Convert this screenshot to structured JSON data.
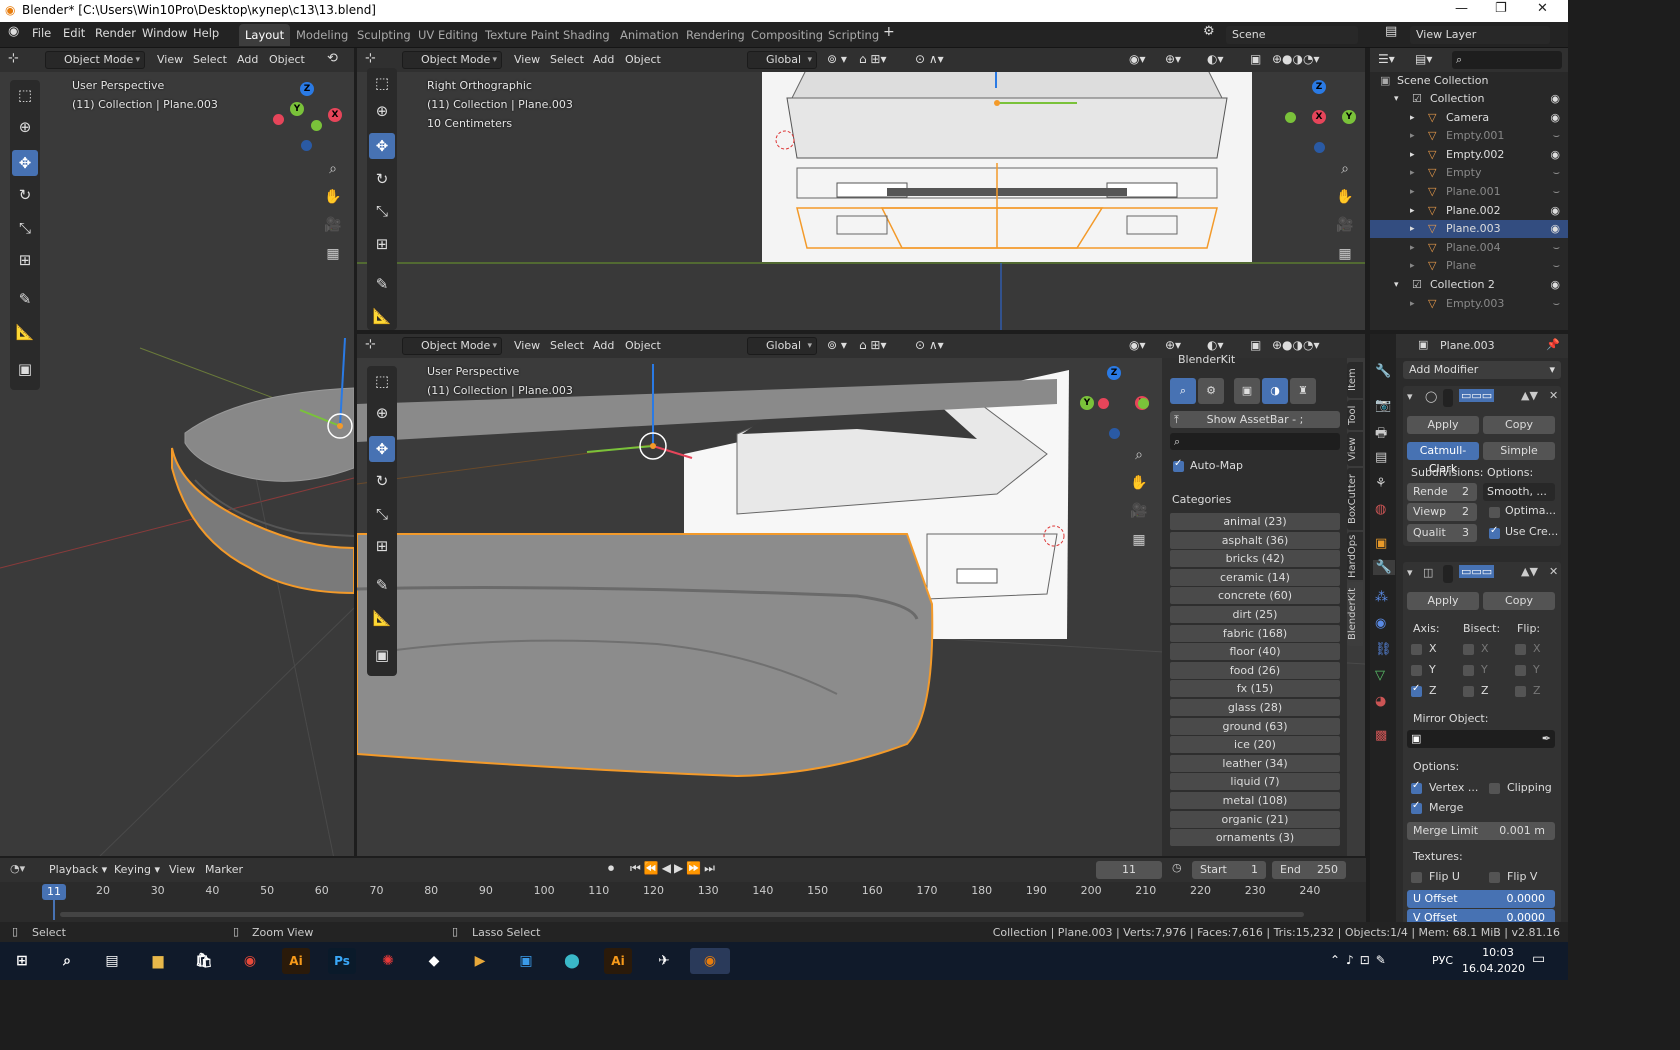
{
  "window": {
    "title": "Blender* [C:\\Users\\Win10Pro\\Desktop\\купер\\c13\\13.blend]"
  },
  "menu": [
    "File",
    "Edit",
    "Render",
    "Window",
    "Help"
  ],
  "workspaces": [
    "Layout",
    "Modeling",
    "Sculpting",
    "UV Editing",
    "Texture Paint",
    "Shading",
    "Animation",
    "Rendering",
    "Compositing",
    "Scripting"
  ],
  "scene": "Scene",
  "view_layer": "View Layer",
  "vp_left": {
    "mode": "Object Mode",
    "menus": [
      "View",
      "Select",
      "Add",
      "Object"
    ],
    "line1": "User Perspective",
    "line2": "(11) Collection | Plane.003"
  },
  "vp_top": {
    "mode": "Object Mode",
    "menus": [
      "View",
      "Select",
      "Add",
      "Object"
    ],
    "orient": "Global",
    "line1": "Right Orthographic",
    "line2": "(11) Collection | Plane.003",
    "line3": "10 Centimeters"
  },
  "vp_main": {
    "mode": "Object Mode",
    "menus": [
      "View",
      "Select",
      "Add",
      "Object"
    ],
    "orient": "Global",
    "line1": "User Perspective",
    "line2": "(11) Collection | Plane.003"
  },
  "gizmo": {
    "x": "X",
    "y": "Y",
    "z": "Z"
  },
  "blenderkit": {
    "title": "BlenderKit",
    "assetbar": "Show AssetBar - ;",
    "automap": "Auto-Map",
    "categories_label": "Categories",
    "categories": [
      "animal (23)",
      "asphalt (36)",
      "bricks (42)",
      "ceramic (14)",
      "concrete (60)",
      "dirt (25)",
      "fabric (168)",
      "floor (40)",
      "food (26)",
      "fx (15)",
      "glass (28)",
      "ground (63)",
      "ice (20)",
      "leather (34)",
      "liquid (7)",
      "metal (108)",
      "organic (21)",
      "ornaments (3)"
    ],
    "tabs": [
      "Item",
      "Tool",
      "View",
      "BoxCutter",
      "HardOps",
      "BlenderKit"
    ]
  },
  "outliner": {
    "root": "Scene Collection",
    "items": [
      {
        "name": "Collection",
        "depth": 1,
        "sel": false,
        "dim": false
      },
      {
        "name": "Camera",
        "depth": 2,
        "sel": false,
        "dim": false
      },
      {
        "name": "Empty.001",
        "depth": 2,
        "sel": false,
        "dim": true
      },
      {
        "name": "Empty.002",
        "depth": 2,
        "sel": false,
        "dim": false
      },
      {
        "name": "Empty",
        "depth": 2,
        "sel": false,
        "dim": true
      },
      {
        "name": "Plane.001",
        "depth": 2,
        "sel": false,
        "dim": true
      },
      {
        "name": "Plane.002",
        "depth": 2,
        "sel": false,
        "dim": false
      },
      {
        "name": "Plane.003",
        "depth": 2,
        "sel": true,
        "dim": false
      },
      {
        "name": "Plane.004",
        "depth": 2,
        "sel": false,
        "dim": true
      },
      {
        "name": "Plane",
        "depth": 2,
        "sel": false,
        "dim": true
      },
      {
        "name": "Collection 2",
        "depth": 1,
        "sel": false,
        "dim": false
      },
      {
        "name": "Empty.003",
        "depth": 2,
        "sel": false,
        "dim": true
      }
    ]
  },
  "props": {
    "object": "Plane.003",
    "add_modifier": "Add Modifier",
    "apply": "Apply",
    "copy": "Copy",
    "catmull": "Catmull-Clark",
    "simple": "Simple",
    "subdivisions": "Subdivisions:",
    "options": "Options:",
    "rende": "Rende",
    "rende_v": "2",
    "viewp": "Viewp",
    "viewp_v": "2",
    "qualit": "Qualit",
    "qualit_v": "3",
    "smooth": "Smooth, ...",
    "optima": "Optima...",
    "usecre": "Use Cre...",
    "axis": "Axis:",
    "bisect": "Bisect:",
    "flip": "Flip:",
    "x": "X",
    "y": "Y",
    "z": "Z",
    "mirror_object": "Mirror Object:",
    "options2": "Options:",
    "vertex": "Vertex ...",
    "clipping": "Clipping",
    "merge": "Merge",
    "merge_limit": "Merge Limit",
    "merge_limit_v": "0.001 m",
    "textures": "Textures:",
    "flipu": "Flip U",
    "flipv": "Flip V",
    "uoffset": "U Offset",
    "uoffset_v": "0.0000",
    "voffset": "V Offset",
    "voffset_v": "0.0000"
  },
  "timeline": {
    "menus": [
      "Playback",
      "Keying",
      "View",
      "Marker"
    ],
    "frame": "11",
    "start_label": "Start",
    "start": "1",
    "end_label": "End",
    "end": "250",
    "current": "11",
    "ticks": [
      "20",
      "30",
      "40",
      "50",
      "60",
      "70",
      "80",
      "90",
      "100",
      "110",
      "120",
      "130",
      "140",
      "150",
      "160",
      "170",
      "180",
      "190",
      "200",
      "210",
      "220",
      "230",
      "240"
    ]
  },
  "status": {
    "select": "Select",
    "zoom": "Zoom View",
    "lasso": "Lasso Select",
    "info": "Collection | Plane.003 | Verts:7,976 | Faces:7,616 | Tris:15,232 | Objects:1/4 | Mem: 68.1 MiB | v2.81.16"
  },
  "taskbar": {
    "lang": "РУС",
    "time": "10:03",
    "date": "16.04.2020",
    "ai": "Ai",
    "ps": "Ps"
  }
}
